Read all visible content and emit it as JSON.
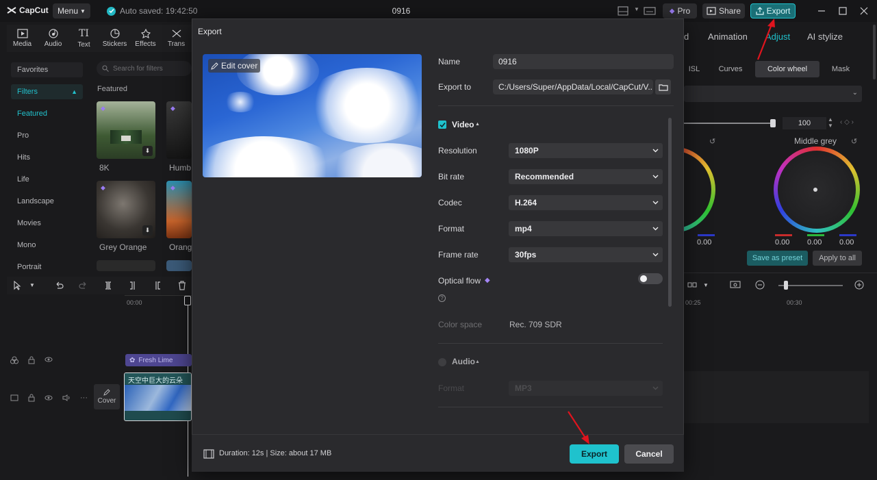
{
  "titlebar": {
    "app_name": "CapCut",
    "menu_label": "Menu",
    "autosave": "Auto saved: 19:42:50",
    "project_title": "0916",
    "pro_label": "Pro",
    "share_label": "Share",
    "export_label": "Export"
  },
  "toolbar": [
    {
      "label": "Media",
      "icon": "media-icon"
    },
    {
      "label": "Audio",
      "icon": "audio-icon"
    },
    {
      "label": "Text",
      "icon": "text-icon"
    },
    {
      "label": "Stickers",
      "icon": "stickers-icon"
    },
    {
      "label": "Effects",
      "icon": "effects-icon"
    },
    {
      "label": "Trans",
      "icon": "transitions-icon"
    }
  ],
  "sidebar": {
    "favorites": "Favorites",
    "filters": "Filters",
    "items": [
      "Featured",
      "Pro",
      "Hits",
      "Life",
      "Landscape",
      "Movies",
      "Mono",
      "Portrait"
    ]
  },
  "filters_panel": {
    "search_placeholder": "Search for filters",
    "section": "Featured",
    "thumbs": [
      "8K",
      "Humb",
      "Grey Orange",
      "Orang"
    ]
  },
  "timeline": {
    "time_start": "00:00",
    "effect_clip": "Fresh Lime",
    "video_clip": "天空中巨大的云朵",
    "cover_label": "Cover",
    "right_time_1": "00:25",
    "right_time_2": "00:30"
  },
  "right_panel": {
    "tabs": [
      "d",
      "Animation",
      "Adjust",
      "AI stylize"
    ],
    "sub_tabs": [
      "ISL",
      "Curves",
      "Color wheel",
      "Mask"
    ],
    "slider_value": "100",
    "middle_grey": "Middle grey",
    "left_wheel_values": [
      "0.00"
    ],
    "wheel_values": [
      "0.00",
      "0.00",
      "0.00"
    ],
    "save_preset": "Save as preset",
    "apply_all": "Apply to all"
  },
  "dialog": {
    "title": "Export",
    "edit_cover": "Edit cover",
    "name_label": "Name",
    "name_value": "0916",
    "export_to_label": "Export to",
    "export_to_value": "C:/Users/Super/AppData/Local/CapCut/V...",
    "video_section": "Video",
    "resolution_label": "Resolution",
    "resolution_value": "1080P",
    "bitrate_label": "Bit rate",
    "bitrate_value": "Recommended",
    "codec_label": "Codec",
    "codec_value": "H.264",
    "format_label": "Format",
    "format_value": "mp4",
    "framerate_label": "Frame rate",
    "framerate_value": "30fps",
    "optical_flow_label": "Optical flow",
    "color_space_label": "Color space",
    "color_space_value": "Rec. 709 SDR",
    "audio_section": "Audio",
    "audio_format_label": "Format",
    "audio_format_value": "MP3",
    "footer_info": "Duration: 12s | Size: about 17 MB",
    "export_button": "Export",
    "cancel_button": "Cancel"
  },
  "colors": {
    "accent": "#1fc2cd",
    "annotation_arrow": "#e0141e"
  }
}
